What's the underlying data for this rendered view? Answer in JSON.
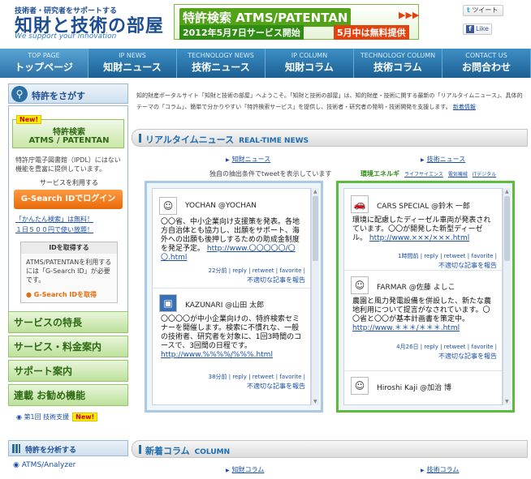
{
  "header": {
    "tagline": "技術者・研究者をサポートする",
    "logo_main": "知財と技術の部屋",
    "logo_sub": "We support your innovation",
    "banner_line1": "特許検索 ATMS/PATENTAN",
    "banner_line2": "2012年5月7日サービス開始",
    "banner_free": "5月中は無料提供",
    "tweet_label": "ツイート",
    "like_label": "Like"
  },
  "nav": [
    {
      "en": "TOP PAGE",
      "jp": "トップページ"
    },
    {
      "en": "IP NEWS",
      "jp": "知財ニュース"
    },
    {
      "en": "TECHNOLOGY NEWS",
      "jp": "技術ニュース"
    },
    {
      "en": "IP COLUMN",
      "jp": "知財コラム"
    },
    {
      "en": "TECHNOLOGY COLUMN",
      "jp": "技術コラム"
    },
    {
      "en": "CONTACT US",
      "jp": "お問合わせ"
    }
  ],
  "sidebar": {
    "search_title": "特許をさがす",
    "new_badge": "New!",
    "atms_line1": "特許検索",
    "atms_line2": "ATMS / PATENTAN",
    "desc": "特許庁電子図書館（IPDL）にはない機能を豊富に提供しています。",
    "use_label": "サービスを利用する",
    "login_label": "G-Search IDでログイン",
    "link1": "「かんたん検索」は無料！",
    "link2": "１日５００円で使い放題！",
    "id_box_title": "IDを取得する",
    "id_box_desc": "ATMS/PATENTANを利用するには「G-Search ID」が必要です。",
    "id_box_link": "G-Search IDを取得",
    "menu": [
      "サービスの特長",
      "サービス・料金案内",
      "サポート案内",
      "連載 お勧め機能"
    ],
    "small_link": "第1回 技術支援",
    "small_new": "New!",
    "analyze_title": "特許を分析する",
    "analyze_link": "ATMS/Analyzer"
  },
  "main": {
    "intro": "知的財産ポータルサイト「知財と技術の部屋」へようこそ。「知財と技術の部屋」は、知的財産・技術に関する最新の「リアルタイムニュース」、具体的テーマの「コラム」、簡単で分かりやすい「特許検索サービス」を提供し、技術者・研究者の発明・技術開発を支援します。",
    "intro_link": "新着情報",
    "realtime_title": "リアルタイムニュース",
    "realtime_en": "REAL-TIME NEWS",
    "col_left_link": "知財ニュース",
    "col_right_link": "技術ニュース",
    "note": "独自の抽出条件でtweetを表示しています",
    "tabs_active": "環境エネルギ",
    "tabs": [
      "ライフサイエンス",
      "電気機械",
      "ITデジタル"
    ],
    "left_tweets": [
      {
        "name": "YOCHAN @YOCHAN",
        "text": "〇〇省、中小企業向け支援策を発表。各地方自治体とも協力し、出願をサポート、海外への出願も後押しするための助成金制度を発足予定。",
        "link": "http://www.〇〇〇〇〇/〇〇.html",
        "meta": "22分前 | reply | retweet | favorite |",
        "report": "不適切な記事を報告",
        "avatar": "person-icon"
      },
      {
        "name": "KAZUNARI @山田 太郎",
        "text": "〇〇〇〇が中小企業向けの、特許検索セミナーを開催します。検索に不慣れな、一般の技術者、研究者を対象に、1回3時間のコースで、3回間の日程です。",
        "link": "http://www.%%%%/%%%.html",
        "meta": "38分前 | reply | retweet | favorite |",
        "report": "不適切な記事を報告",
        "avatar": "monitor-icon"
      }
    ],
    "right_tweets": [
      {
        "name": "CARS SPECIAL @鈴木 一郎",
        "text": "環境に配慮したディーゼル車両が発表されています。〇〇が開発した新型ディーゼル。",
        "link": "http://www.×××/×××.html",
        "meta": "1時間前 | reply | retweet | favorite |",
        "report": "不適切な記事を報告",
        "avatar": "car-icon"
      },
      {
        "name": "FARMAR @佐藤 よしこ",
        "text": "農園と風力発電設備を併設した、新たな農地利用について提言がなされています。〇〇省と〇〇が基本計画書を策定中。",
        "link": "http://www.＊＊＊/＊＊＊.html",
        "meta": "4月26日 | reply | retweet | favorite |",
        "report": "不適切な記事を報告",
        "avatar": "person-icon"
      },
      {
        "name": "Hiroshi Kaji @加治 博",
        "text": "",
        "link": "",
        "meta": "",
        "report": "",
        "avatar": "person-icon"
      }
    ],
    "column_title": "新着コラム",
    "column_en": "COLUMN",
    "column_left_link": "知財コラム",
    "column_right_link": "技術コラム"
  }
}
